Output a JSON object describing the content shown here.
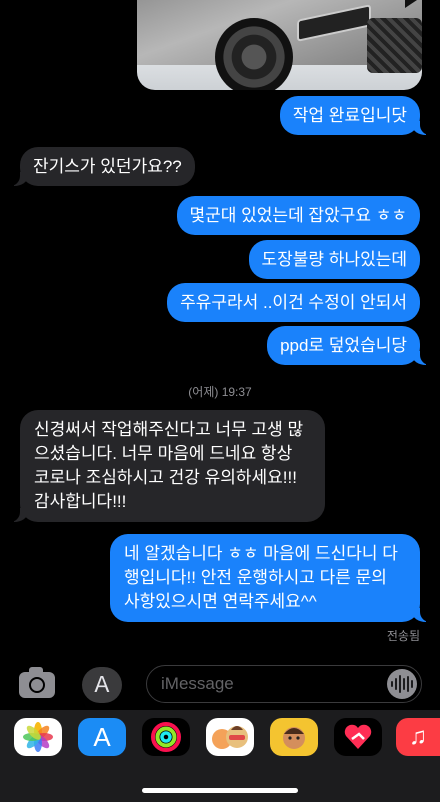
{
  "messages": [
    {
      "side": "out",
      "text": "작업 완료입니닷"
    },
    {
      "side": "in",
      "text": "잔기스가 있던가요??"
    },
    {
      "side": "out",
      "text": "몇군대 있었는데 잡았구요 ㅎㅎ"
    },
    {
      "side": "out",
      "text": "도장불량 하나있는데"
    },
    {
      "side": "out",
      "text": "주유구라서 ..이건 수정이 안되서"
    },
    {
      "side": "out",
      "text": "ppd로 덮었습니당"
    },
    {
      "side": "in",
      "text": "신경써서 작업해주신다고 너무 고생 많으셨습니다. 너무 마음에 드네요 항상 코로나 조심하시고 건강 유의하세요!!! 감사합니다!!!"
    },
    {
      "side": "out",
      "text": "네 알겠습니다 ㅎㅎ 마음에 드신다니 다행입니다!! 안전 운행하시고 다른 문의 사항있으시면 연락주세요^^"
    }
  ],
  "timestamp": "(어제) 19:37",
  "delivered": "전송됨",
  "input": {
    "placeholder": "iMessage"
  },
  "app_drawer": [
    "photos-icon",
    "appstore-icon",
    "activity-icon",
    "memoji-stickers-icon",
    "animoji-icon",
    "digital-touch-icon",
    "music-icon"
  ],
  "colors": {
    "outgoing": "#1a82fb",
    "incoming": "#262629",
    "background": "#000000"
  }
}
